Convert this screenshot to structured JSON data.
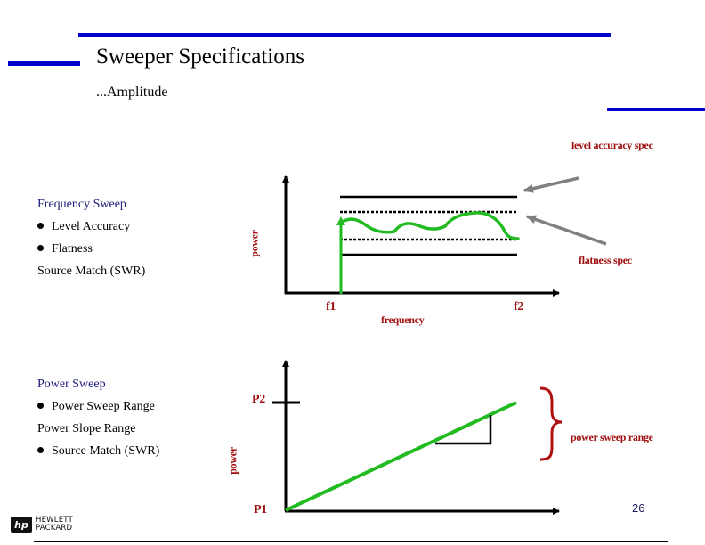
{
  "header": {
    "title": "Sweeper Specifications",
    "subtitle": "...Amplitude"
  },
  "colors": {
    "accent_blue": "#0000cc",
    "label_red": "#a01010",
    "trace_green": "#22bb22",
    "arrow_gray": "#808080",
    "section_navy": "#1a1a7a"
  },
  "frequency_section": {
    "heading": "Frequency Sweep",
    "items": [
      {
        "label": "Level Accuracy",
        "bullet": true
      },
      {
        "label": "Flatness",
        "bullet": true
      },
      {
        "label": "Source Match (SWR)",
        "bullet": false
      }
    ]
  },
  "power_section": {
    "heading": "Power Sweep",
    "items": [
      {
        "label": "Power Sweep Range",
        "bullet": true
      },
      {
        "label": "Power Slope Range",
        "bullet": false
      },
      {
        "label": "Source Match (SWR)",
        "bullet": true
      }
    ]
  },
  "frequency_diagram": {
    "y_axis_label": "power",
    "x_axis_label": "frequency",
    "f1_label": "f1",
    "f2_label": "f2",
    "level_accuracy_label": "level accuracy spec",
    "flatness_label": "flatness spec"
  },
  "power_diagram": {
    "y_axis_label": "power",
    "p1_label": "P1",
    "p2_label": "P2",
    "range_label": "power sweep range"
  },
  "footer": {
    "logo_line1": "HEWLETT",
    "logo_line2": "PACKARD",
    "logo_mark": "hp",
    "page_number": "26"
  }
}
